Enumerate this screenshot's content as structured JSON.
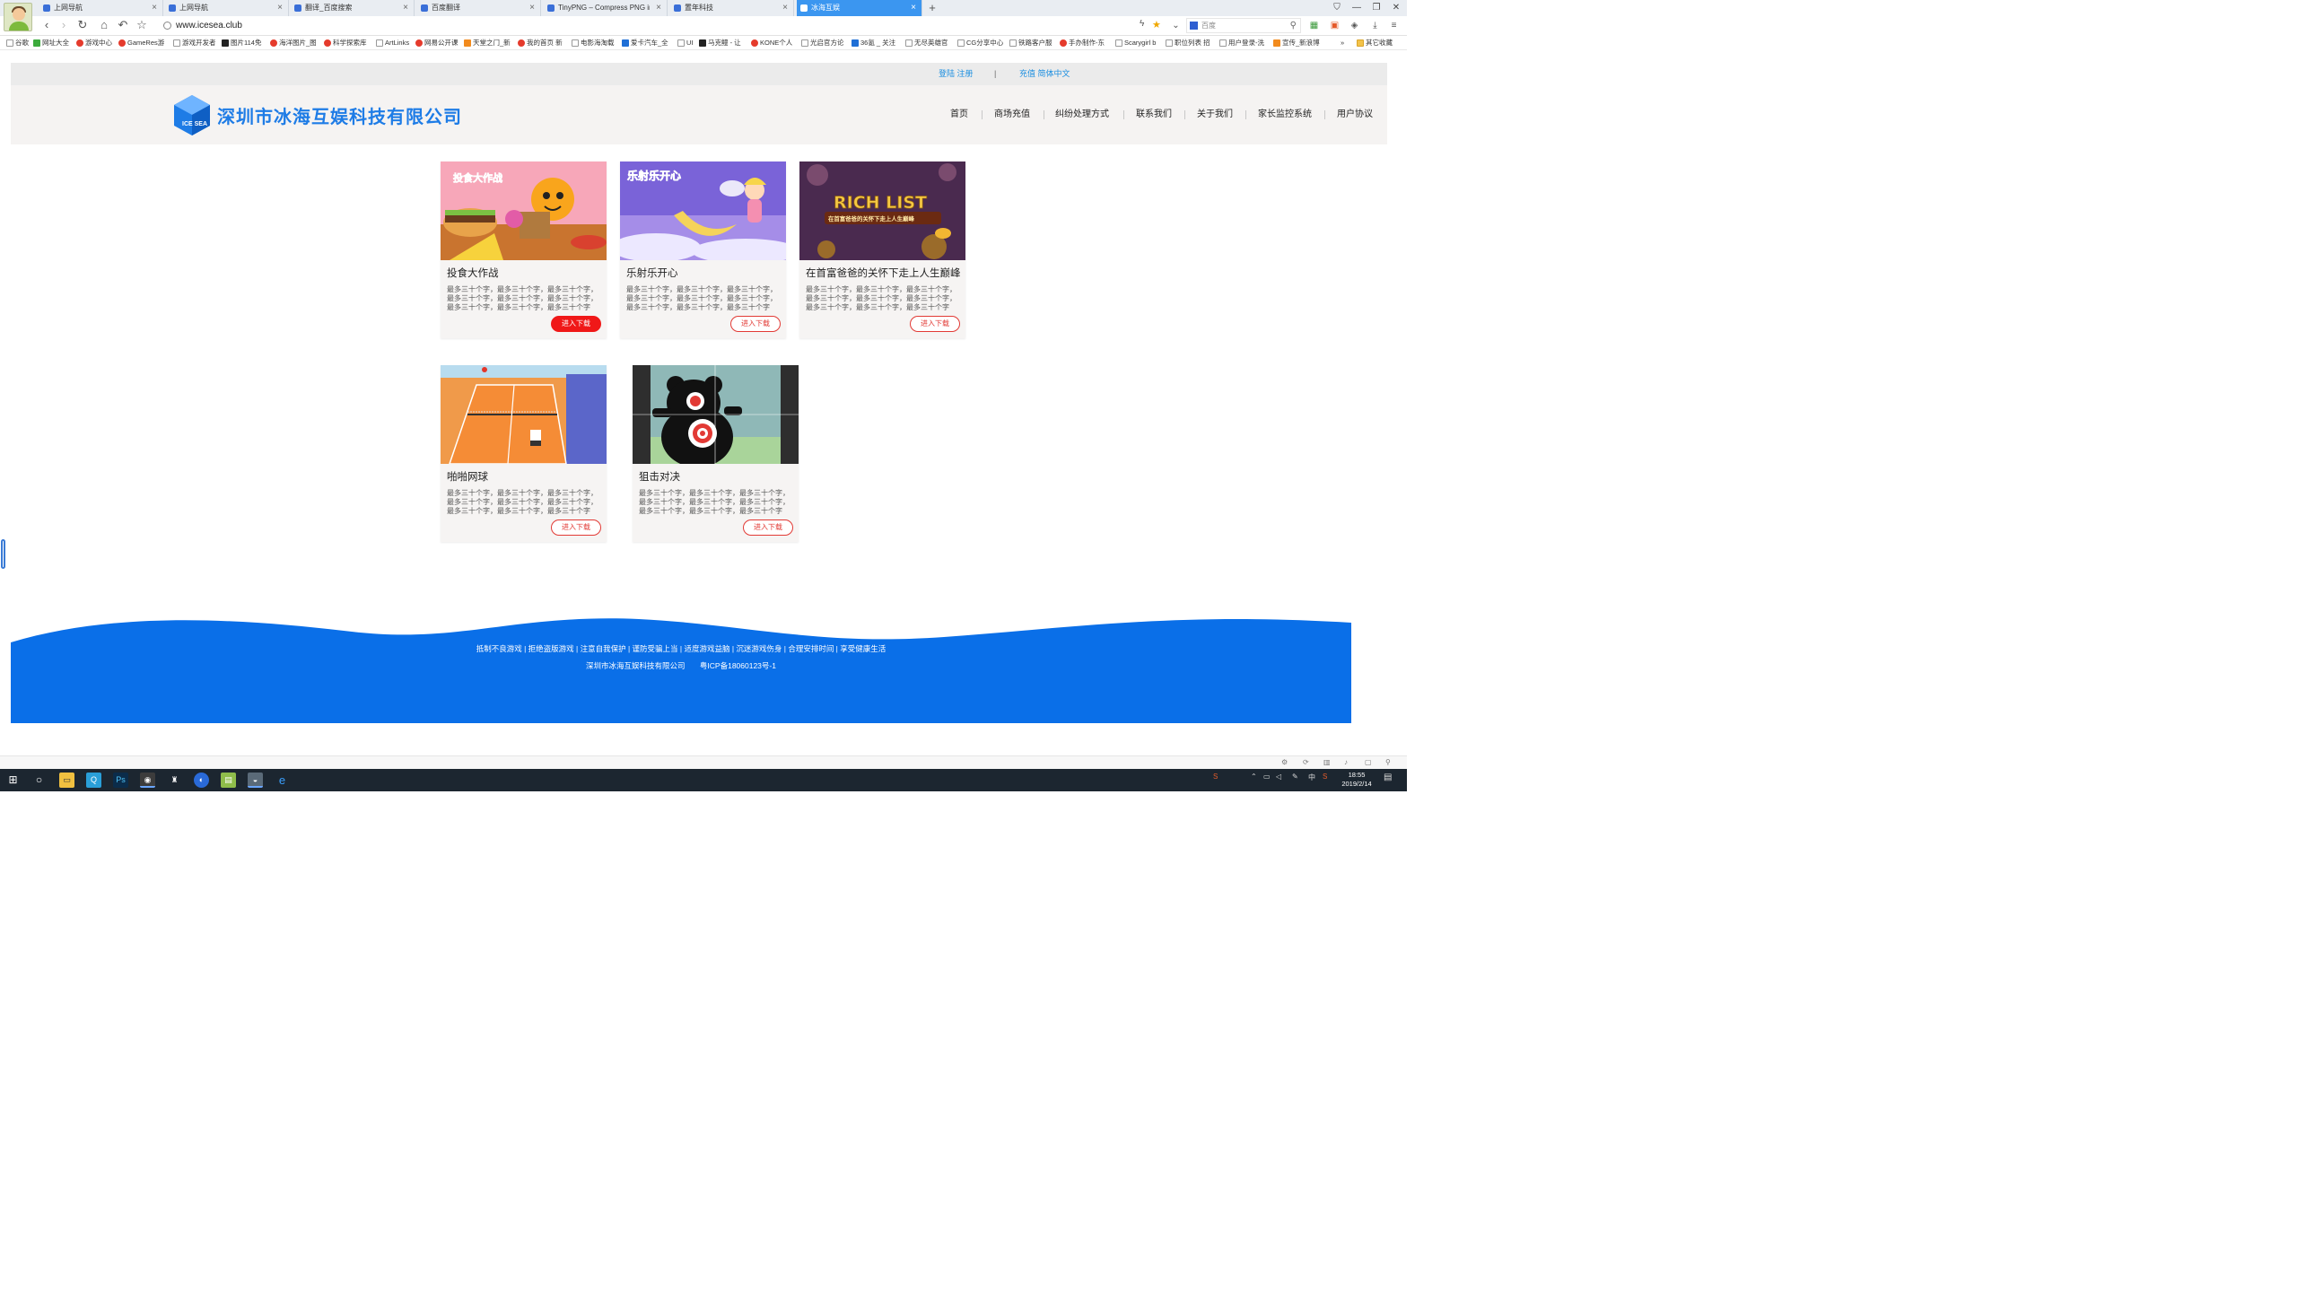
{
  "browser": {
    "tabs": [
      {
        "label": "上网导航",
        "active": false
      },
      {
        "label": "上网导航",
        "active": false
      },
      {
        "label": "翻译_百度搜索",
        "active": false
      },
      {
        "label": "百度翻译",
        "active": false
      },
      {
        "label": "TinyPNG – Compress PNG im",
        "active": false
      },
      {
        "label": "置年科技",
        "active": false
      },
      {
        "label": "冰海互娱",
        "active": true
      }
    ],
    "url": "www.icesea.club",
    "search_placeholder": "百度",
    "bookmarks": [
      "谷歌",
      "网址大全",
      "游戏中心",
      "GameRes游",
      "游戏开发者",
      "图片114免",
      "海洋图片_图",
      "科学探索库",
      "ArtLinks",
      "网易公开课",
      "天堂之门_新",
      "我的首页 新",
      "电影海淘载",
      "爱卡汽车_全",
      "UI",
      "马克鳗 - 让",
      "KONE个人",
      "光启官方论",
      "36氪 _ 关注",
      "无尽英雄官",
      "CG分享中心",
      "铁路客户服",
      "手办制作-东",
      "Scarygirl b",
      "职位列表 招",
      "用户登录-洗",
      "宣传_新浪博"
    ],
    "bookmarks_more": "»",
    "bookmarks_other": "其它收藏"
  },
  "site": {
    "top_links": {
      "login": "登陆 注册",
      "separator": "|",
      "extra": "充值 简体中文"
    },
    "logo_text": "深圳市冰海互娱科技有限公司",
    "logo_badge": "ICE SEA",
    "nav": [
      "首页",
      "商场充值",
      "纠纷处理方式",
      "联系我们",
      "关于我们",
      "家长监控系统",
      "用户协议"
    ],
    "games": [
      {
        "title": "投食大作战",
        "desc": "最多三十个字，最多三十个字，最多三十个字，最多三十个字，最多三十个字，最多三十个字，最多三十个字，最多三十个字，最多三十个字",
        "button": "进入下载",
        "thumb_text": "投食大作战"
      },
      {
        "title": "乐射乐开心",
        "desc": "最多三十个字，最多三十个字，最多三十个字，最多三十个字，最多三十个字，最多三十个字，最多三十个字，最多三十个字，最多三十个字",
        "button": "进入下载",
        "thumb_text": "乐射乐开心"
      },
      {
        "title": "在首富爸爸的关怀下走上人生巅峰",
        "desc": "最多三十个字，最多三十个字，最多三十个字，最多三十个字，最多三十个字，最多三十个字，最多三十个字，最多三十个字，最多三十个字",
        "button": "进入下载",
        "thumb_text": "RICH LIST",
        "thumb_sub": "在首富爸爸的关怀下走上人生巅峰"
      },
      {
        "title": "啪啪网球",
        "desc": "最多三十个字，最多三十个字，最多三十个字，最多三十个字，最多三十个字，最多三十个字，最多三十个字，最多三十个字，最多三十个字",
        "button": "进入下载"
      },
      {
        "title": "狙击对决",
        "desc": "最多三十个字，最多三十个字，最多三十个字，最多三十个字，最多三十个字，最多三十个字，最多三十个字，最多三十个字，最多三十个字",
        "button": "进入下载"
      }
    ],
    "footer": {
      "line1": "抵制不良游戏 | 拒绝盗版游戏 | 注意自我保护 | 谨防受骗上当 | 适度游戏益脑 | 沉迷游戏伤身 | 合理安排时间 | 享受健康生活",
      "company": "深圳市冰海互娱科技有限公司",
      "icp": "粤ICP备18060123号-1"
    }
  },
  "taskbar": {
    "time": "18:55",
    "date": "2019/2/14",
    "ime": "中"
  },
  "colors": {
    "brand_blue": "#1e7ce6",
    "footer_blue": "#0a6fe8",
    "tab_active": "#3b96f0",
    "button_red": "#f01818"
  }
}
